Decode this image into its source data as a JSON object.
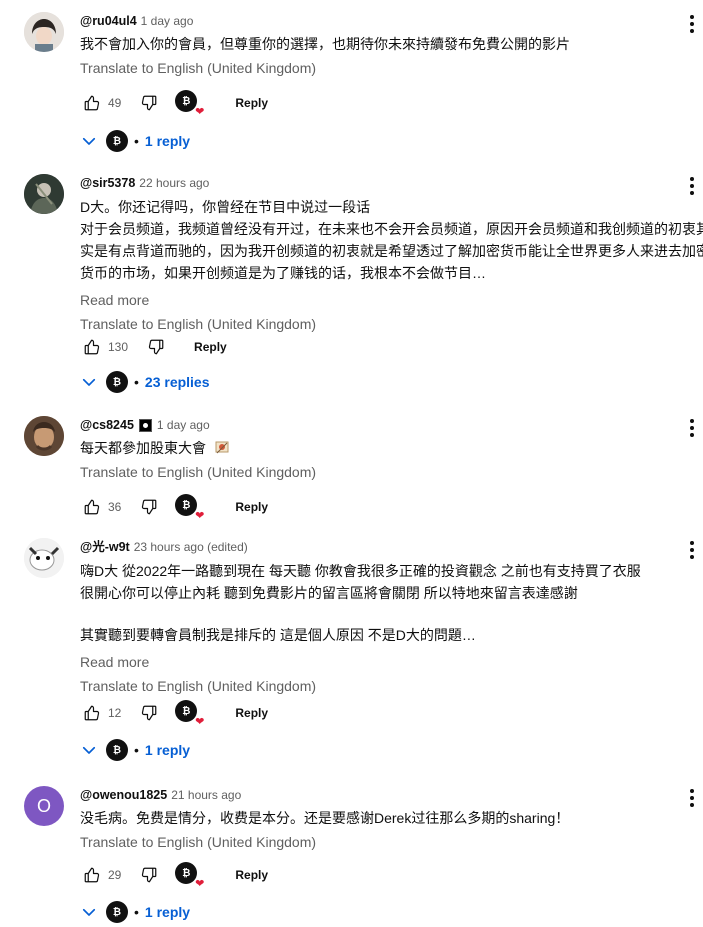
{
  "colors": {
    "link": "#065fd4",
    "meta": "#606060",
    "heart": "#e01e3a"
  },
  "labels": {
    "translate": "Translate to English (United Kingdom)",
    "reply": "Reply",
    "read_more": "Read more"
  },
  "comments": [
    {
      "author": "@ru04ul4",
      "time": "1 day ago",
      "lines": [
        "我不會加入你的會員，但尊重你的選擇，也期待你未來持續發布免費公開的影片"
      ],
      "likes": "49",
      "replies": "1 reply"
    },
    {
      "author": "@sir5378",
      "time": "22 hours ago",
      "lines": [
        "D大。你还记得吗，你曾经在节目中说过一段话",
        "对于会员频道，我频道曾经没有开过，在未来也不会开会员频道，原因开会员频道和我创频道的初衷其",
        "实是有点背道而驰的，因为我开创频道的初衷就是希望透过了解加密货币能让全世界更多人来进去加密",
        "货币的市场，如果开创频道是为了赚钱的话，我根本不会做节目…"
      ],
      "likes": "130",
      "replies": "23 replies"
    },
    {
      "author": "@cs8245",
      "time": "1 day ago",
      "lines": [
        "每天都參加股東大會"
      ],
      "likes": "36"
    },
    {
      "author": "@光-w9t",
      "time": "23 hours ago (edited)",
      "lines": [
        "嗨D大 從2022年一路聽到現在 每天聽 你教會我很多正確的投資觀念 之前也有支持買了衣服",
        "很開心你可以停止內耗 聽到免費影片的留言區將會關閉 所以特地來留言表達感謝",
        "",
        "其實聽到要轉會員制我是排斥的 這是個人原因 不是D大的問題…"
      ],
      "likes": "12",
      "replies": "1 reply"
    },
    {
      "author": "@owenou1825",
      "time": "21 hours ago",
      "avatar_letter": "O",
      "lines": [
        "没毛病。免费是情分，收费是本分。还是要感谢Derek过往那么多期的sharing！"
      ],
      "likes": "29",
      "replies": "1 reply"
    }
  ]
}
